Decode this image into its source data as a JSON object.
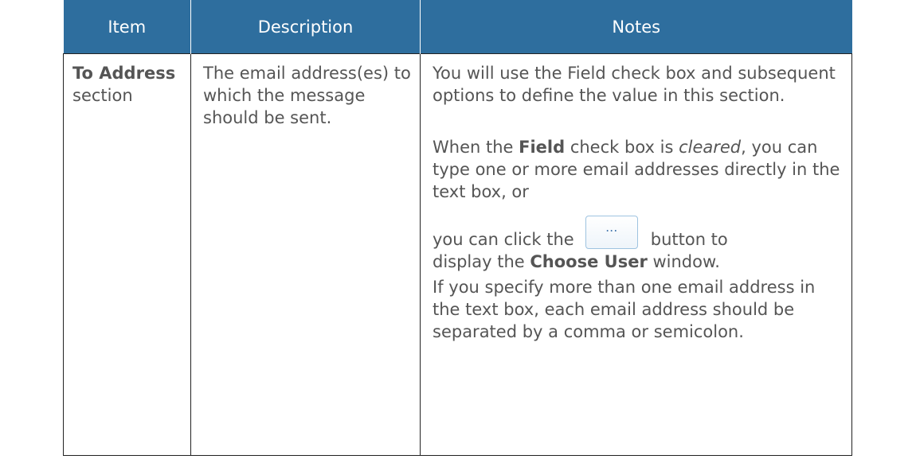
{
  "table": {
    "headers": [
      "Item",
      "Description",
      "Notes"
    ],
    "row": {
      "item_bold": "To Address",
      "item_rest": "section",
      "description": "The email address(es) to which the message should be sent.",
      "notes": {
        "p1": "You will use the Field check box and subsequent options to define the value in this section.",
        "p2_a": "When the ",
        "p2_b": "Field",
        "p2_c": " check box is ",
        "p2_d": "cleared",
        "p2_e": ", you can type one or more email addresses directly in the text box, or",
        "p3_a": "you can click the",
        "button_label": "...",
        "p3_b": "button to",
        "p4_a": "display the ",
        "p4_b": "Choose User",
        "p4_c": " window.",
        "p5": "If you specify more than one email address in the text box, each email address should be separated by a comma or semicolon."
      }
    }
  }
}
